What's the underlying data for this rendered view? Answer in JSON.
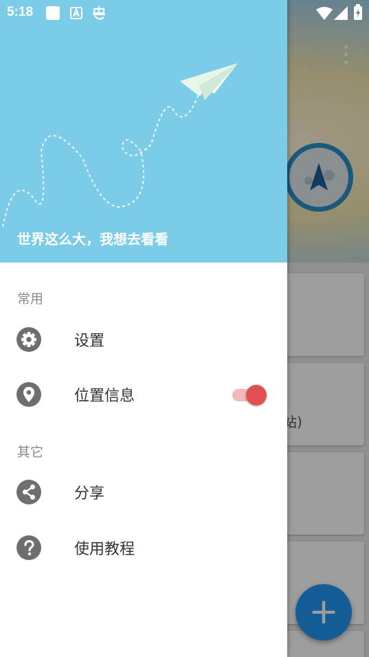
{
  "status_bar": {
    "time": "5:18",
    "icons": [
      "notification-square-icon",
      "font-a-icon",
      "bug-icon",
      "wifi-icon",
      "signal-icon",
      "battery-charging-icon"
    ]
  },
  "drawer": {
    "header": {
      "slogan": "世界这么大，我想去看看",
      "background_color": "#7dcce7",
      "decoration": "paper-plane-icon"
    },
    "sections": [
      {
        "title": "常用",
        "items": [
          {
            "label": "设置",
            "icon": "gear-icon"
          },
          {
            "label": "位置信息",
            "icon": "location-pin-icon",
            "toggle": true
          }
        ]
      },
      {
        "title": "其它",
        "items": [
          {
            "label": "分享",
            "icon": "share-icon"
          },
          {
            "label": "使用教程",
            "icon": "help-icon"
          }
        ]
      }
    ]
  },
  "background": {
    "card_text_fragment": "站)",
    "fab_label": "+",
    "accent_color": "#2196f3"
  }
}
